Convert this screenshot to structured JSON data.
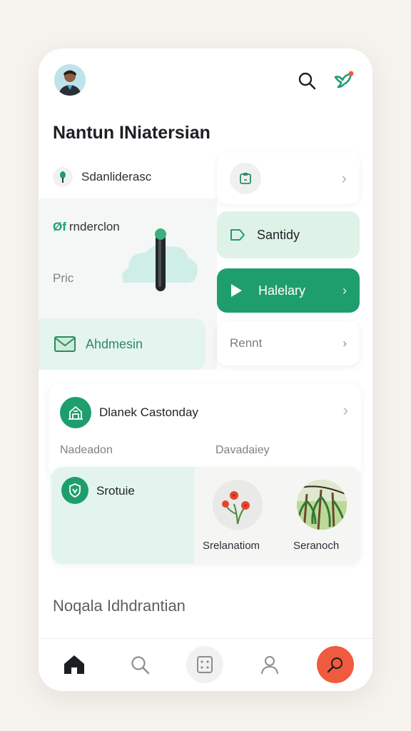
{
  "header": {
    "title": "Nantun INiatersian",
    "avatar": "profile-photo",
    "search_icon": "search-icon",
    "notification_icon": "bird-icon",
    "notification_dot_color": "#f05a3e"
  },
  "left_panel": {
    "top_item": "Sdanliderasc",
    "green_label_prefix": "Øf",
    "green_label": "rnderclon",
    "gray_label": "Pric",
    "highlight_card": "Ahdmesin"
  },
  "right_cards": {
    "card1_icon": "clipboard-icon",
    "card2_label": "Santidy",
    "card3_label": "Halelary",
    "card4_label": "Rennt"
  },
  "middle_card": {
    "title": "Dlanek Castonday",
    "left_label": "Nadeadon",
    "right_label": "Davadaiey"
  },
  "bottom_card": {
    "title": "Srotuie",
    "item1_label": "Srelanatiom",
    "item2_label": "Seranoch"
  },
  "section_title": "Noqala Idhdrantian",
  "nav": {
    "items": [
      "home-icon",
      "search-icon",
      "grid-icon",
      "profile-icon",
      "add-icon"
    ]
  },
  "colors": {
    "accent": "#1f9e6d",
    "accent_light": "#dff2e8",
    "fab": "#f05a3e"
  }
}
